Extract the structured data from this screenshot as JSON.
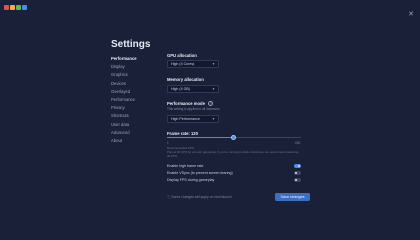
{
  "window": {
    "close_glyph": "✕"
  },
  "settings": {
    "title": "Settings",
    "nav": [
      {
        "label": "Performance",
        "active": true
      },
      {
        "label": "Display"
      },
      {
        "label": "Graphics"
      },
      {
        "label": "Devices"
      },
      {
        "label": "Overlayed"
      },
      {
        "label": "Performance"
      },
      {
        "label": "Privacy"
      },
      {
        "label": "Shortcuts"
      },
      {
        "label": "User data"
      },
      {
        "label": "Advanced"
      },
      {
        "label": "About"
      }
    ],
    "gpu": {
      "label": "GPU allocation",
      "value": "High (4 Cores)"
    },
    "memory": {
      "label": "Memory allocation",
      "value": "High (4 GB)"
    },
    "performance_mode": {
      "label": "Performance mode",
      "help": "?",
      "subtitle": "This setting is applied to all instances",
      "value": "High Performance"
    },
    "frame_rate": {
      "label": "Frame rate: 120",
      "min_label": "1",
      "max_label": "240",
      "value": 120,
      "min": 1,
      "max": 240,
      "hint1": "Recommended FPS",
      "hint2": "Play at 60 FPS for smooth gameplay. If you're running multiple instances, we recommend selecting 30 FPS."
    },
    "toggles": [
      {
        "label": "Enable high frame rate",
        "on": true
      },
      {
        "label": "Enable VSync (to prevent screen tearing)",
        "on": false
      },
      {
        "label": "Display FPS during gameplay",
        "on": false
      }
    ],
    "footer_note": "Some changes will apply on next launch",
    "footer_icon": "info-icon",
    "save_label": "Save changes"
  },
  "colors": {
    "background": "#1a2038",
    "accent": "#4c8be8",
    "button": "#3a6fc2"
  }
}
